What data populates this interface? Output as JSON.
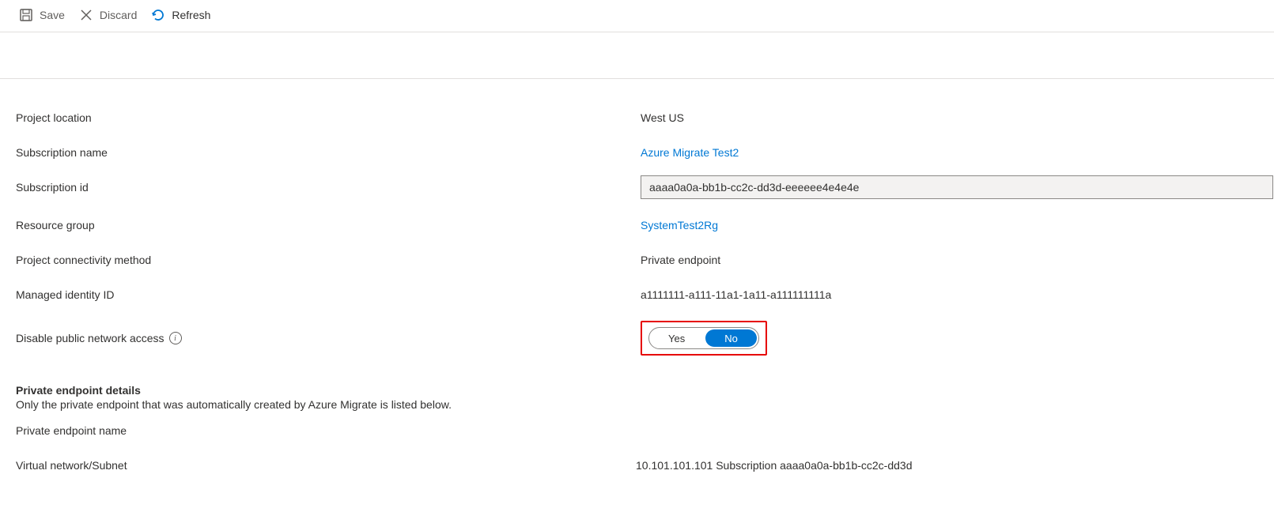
{
  "toolbar": {
    "save": "Save",
    "discard": "Discard",
    "refresh": "Refresh"
  },
  "fields": {
    "project_location": {
      "label": "Project location",
      "value": "West US"
    },
    "subscription_name": {
      "label": "Subscription name",
      "value": "Azure Migrate Test2"
    },
    "subscription_id": {
      "label": "Subscription id",
      "value": "aaaa0a0a-bb1b-cc2c-dd3d-eeeeee4e4e4e"
    },
    "resource_group": {
      "label": "Resource group",
      "value": "SystemTest2Rg"
    },
    "connectivity_method": {
      "label": "Project connectivity method",
      "value": "Private endpoint"
    },
    "managed_identity": {
      "label": "Managed identity ID",
      "value": "a1111111-a111-11a1-1a11-a111111111a"
    },
    "disable_public": {
      "label": "Disable public network access",
      "yes": "Yes",
      "no": "No"
    }
  },
  "section": {
    "title": "Private endpoint details",
    "desc": "Only the private endpoint that was automatically created by Azure Migrate is listed below.",
    "endpoint_name_label": "Private endpoint name",
    "vnet_label": "Virtual network/Subnet",
    "vnet_value": "10.101.101.101 Subscription aaaa0a0a-bb1b-cc2c-dd3d"
  }
}
